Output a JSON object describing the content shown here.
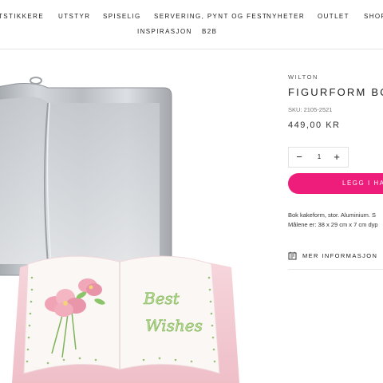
{
  "nav": {
    "row1": [
      "TSTIKKERE",
      "UTSTYR",
      "SPISELIG",
      "SERVERING, PYNT OG FEST",
      "NYHETER",
      "OUTLET",
      "SHOP"
    ],
    "row2": [
      "INSPIRASJON",
      "B2B"
    ]
  },
  "product": {
    "brand": "WILTON",
    "title": "FIGURFORM BO",
    "sku": "SKU: 2105-2521",
    "price": "449,00 KR",
    "quantity": "1",
    "add_to_cart": "LEGG I HAN",
    "description": [
      "Bok kakeform, stor. Aluminium. S",
      "Målene er: 38 x 29 cm x 7 cm dyp"
    ],
    "more_info": "MER INFORMASJON",
    "image_text": {
      "line1": "Best",
      "line2": "Wishes"
    }
  },
  "colors": {
    "accent": "#ee1c7a"
  },
  "icons": {
    "minus": "minus-icon",
    "plus": "plus-icon",
    "info": "info-box-icon"
  }
}
